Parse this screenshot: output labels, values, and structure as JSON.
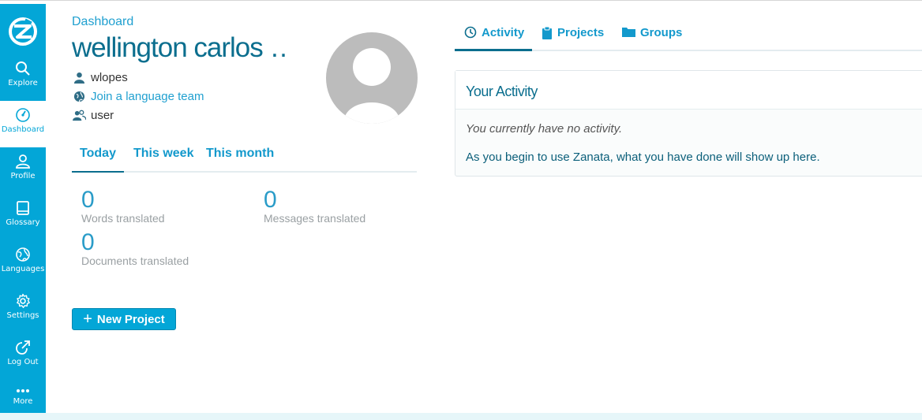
{
  "sidebar": {
    "items": [
      {
        "label": "Explore",
        "icon": "search-icon"
      },
      {
        "label": "Dashboard",
        "icon": "dashboard-icon",
        "active": true
      },
      {
        "label": "Profile",
        "icon": "user-icon"
      },
      {
        "label": "Glossary",
        "icon": "book-icon"
      },
      {
        "label": "Languages",
        "icon": "globe-icon"
      },
      {
        "label": "Settings",
        "icon": "gear-icon"
      },
      {
        "label": "Log Out",
        "icon": "logout-icon"
      },
      {
        "label": "More",
        "icon": "more-icon"
      }
    ]
  },
  "header": {
    "breadcrumb": "Dashboard",
    "username": "wellington carlos …"
  },
  "profile": {
    "login": "wlopes",
    "join_team": "Join a language team",
    "role": "user"
  },
  "period_tabs": [
    {
      "label": "Today",
      "active": true
    },
    {
      "label": "This week"
    },
    {
      "label": "This month"
    }
  ],
  "stats": {
    "words": {
      "value": "0",
      "label": "Words translated"
    },
    "messages": {
      "value": "0",
      "label": "Messages translated"
    },
    "documents": {
      "value": "0",
      "label": "Documents translated"
    }
  },
  "actions": {
    "new_project": "New Project"
  },
  "right_tabs": [
    {
      "label": "Activity",
      "icon": "clock-icon",
      "active": true
    },
    {
      "label": "Projects",
      "icon": "clipboard-icon"
    },
    {
      "label": "Groups",
      "icon": "folder-icon"
    }
  ],
  "activity": {
    "title": "Your Activity",
    "empty": "You currently have no activity.",
    "hint": "As you begin to use Zanata, what you have done will show up here."
  },
  "colors": {
    "accent": "#03a6d7",
    "heading": "#0b6e8e",
    "link": "#20a0d0"
  }
}
